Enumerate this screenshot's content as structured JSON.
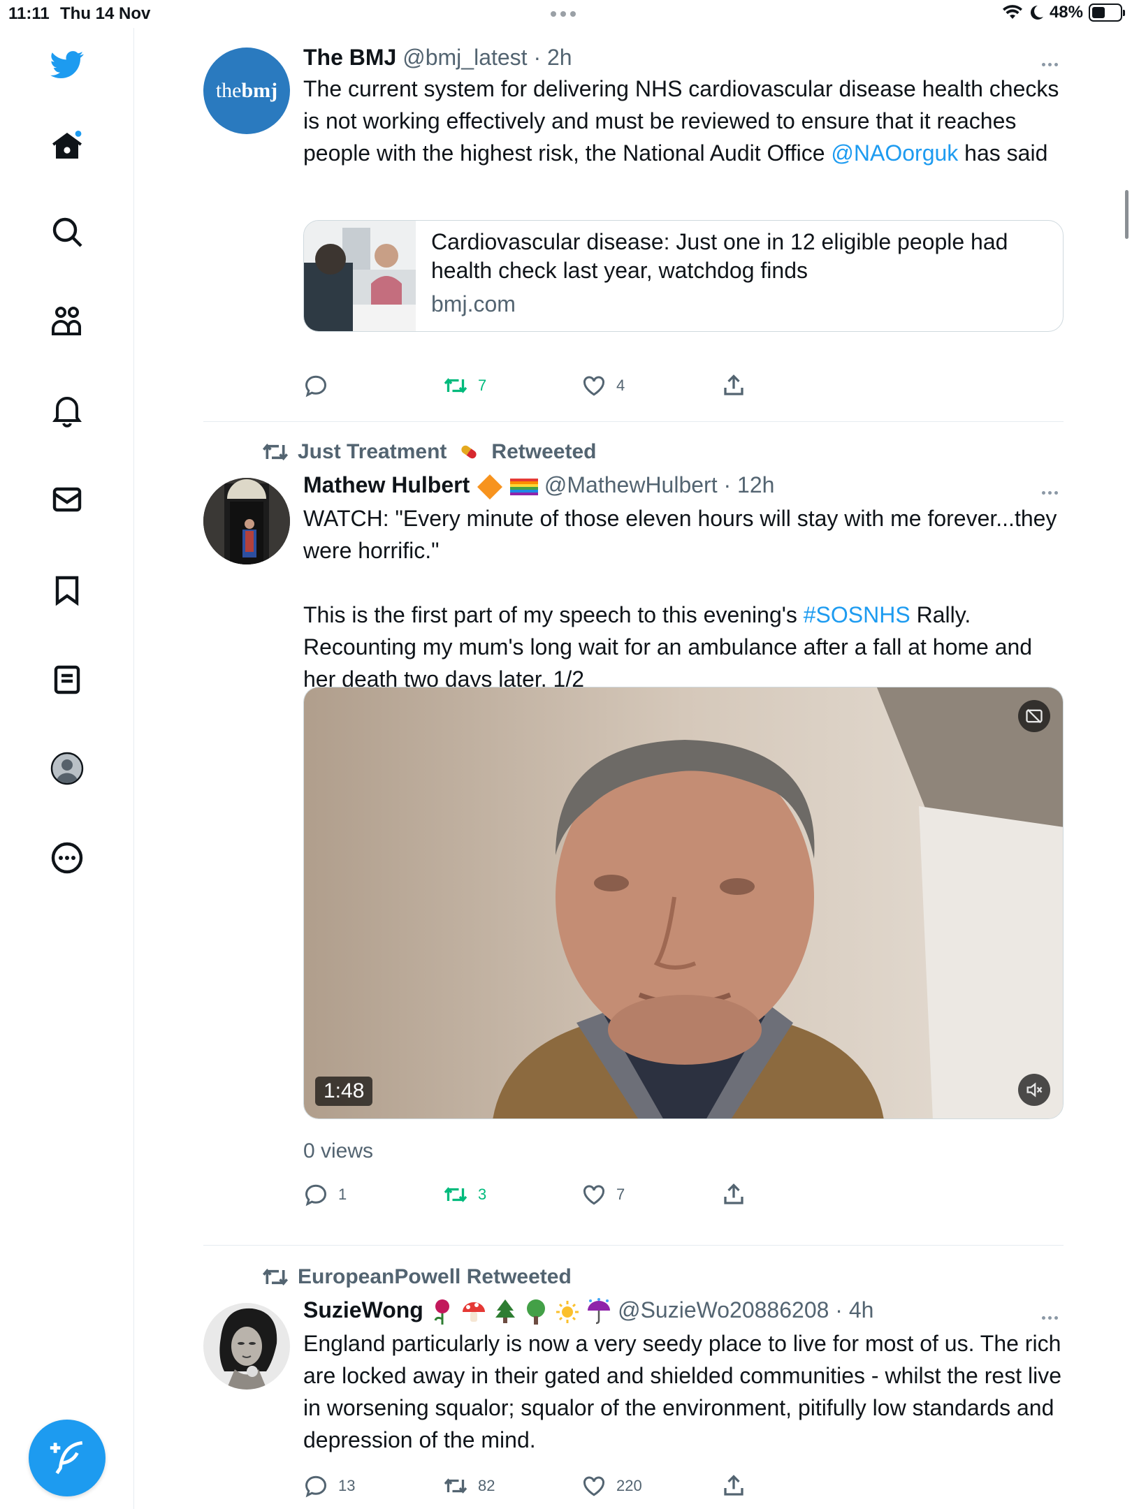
{
  "status_bar": {
    "time": "11:11",
    "date": "Thu 14 Nov",
    "battery": "48%",
    "battery_level": 0.48
  },
  "sidebar": {
    "items": [
      {
        "name": "home"
      },
      {
        "name": "explore"
      },
      {
        "name": "communities"
      },
      {
        "name": "notifications"
      },
      {
        "name": "messages"
      },
      {
        "name": "bookmarks"
      },
      {
        "name": "lists"
      },
      {
        "name": "profile"
      },
      {
        "name": "more"
      }
    ]
  },
  "tweets": [
    {
      "avatar_text": {
        "light": "the",
        "bold": "bmj"
      },
      "name": "The BMJ",
      "handle": "@bmj_latest",
      "sep": " · ",
      "time": "2h",
      "text_parts": [
        "The current system for delivering NHS cardiovascular disease health checks is not working effectively and must be reviewed to ensure that it reaches people with the highest risk, the National Audit Office ",
        "@NAOorguk",
        " has said"
      ],
      "card": {
        "title": "Cardiovascular disease: Just one in 12 eligible people had health check last year, watchdog finds",
        "domain": "bmj.com"
      },
      "replies": "",
      "retweets": "7",
      "likes": "4"
    },
    {
      "retweeted_by": "Just Treatment",
      "retweeted_label": "Retweeted",
      "name": "Mathew Hulbert",
      "handle": "@MathewHulbert",
      "sep": " · ",
      "time": "12h",
      "text_line1": "WATCH: \"Every minute of those eleven hours will stay with me forever...they were horrific.\"",
      "text_p2_before": "This is the first part of my speech to this evening's ",
      "hashtag": "#SOSNHS",
      "text_p2_after": " Rally. Recounting my mum's long wait for an ambulance after a fall at home and her death two days later. 1/2",
      "video_duration": "1:48",
      "views": "0 views",
      "replies": "1",
      "retweets": "3",
      "likes": "7"
    },
    {
      "retweeted_by": "EuropeanPowell",
      "retweeted_label": "Retweeted",
      "name": "SuzieWong",
      "handle": "@SuzieWo20886208",
      "sep": " · ",
      "time": "4h",
      "text": "England particularly is now a very seedy place to live for most of us. The rich are locked away in their gated and shielded communities - whilst the rest live in worsening squalor; squalor of the environment, pitifully low standards and depression of the mind.",
      "replies": "13",
      "retweets": "82",
      "likes": "220"
    }
  ],
  "colors": {
    "accent": "#1d9bf0",
    "retweet_green": "#00ba7c",
    "muted": "#536471",
    "bmj_blue": "#2a7abf"
  }
}
